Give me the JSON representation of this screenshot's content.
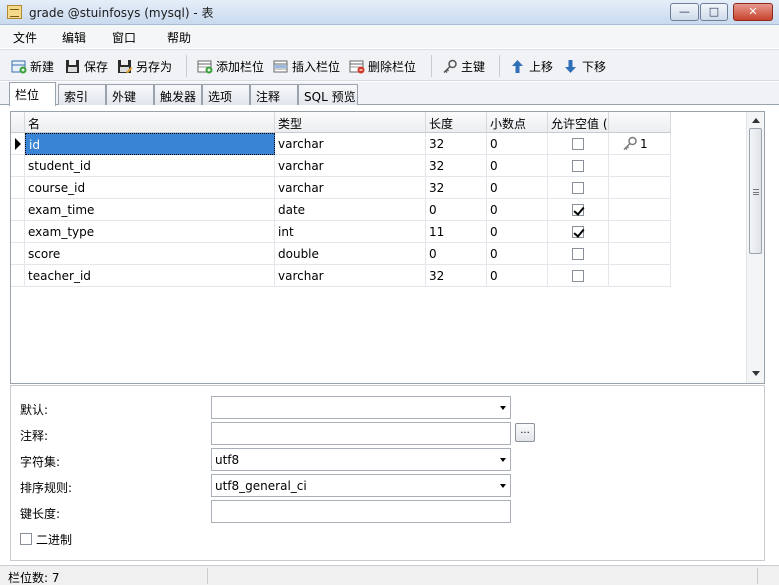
{
  "window": {
    "title": "grade @stuinfosys (mysql) - 表"
  },
  "menu": [
    "文件",
    "编辑",
    "窗口",
    "帮助"
  ],
  "toolbar": {
    "new": "新建",
    "save": "保存",
    "save_as": "另存为",
    "add_field": "添加栏位",
    "insert_field": "插入栏位",
    "delete_field": "删除栏位",
    "primary_key": "主键",
    "move_up": "上移",
    "move_down": "下移"
  },
  "tabs": [
    "栏位",
    "索引",
    "外键",
    "触发器",
    "选项",
    "注释",
    "SQL 预览"
  ],
  "grid": {
    "headers": [
      "名",
      "类型",
      "长度",
      "小数点",
      "允许空值 (",
      ""
    ],
    "rows": [
      {
        "name": "id",
        "type": "varchar",
        "length": "32",
        "decimals": "0",
        "nullable": false,
        "key": "1"
      },
      {
        "name": "student_id",
        "type": "varchar",
        "length": "32",
        "decimals": "0",
        "nullable": false,
        "key": ""
      },
      {
        "name": "course_id",
        "type": "varchar",
        "length": "32",
        "decimals": "0",
        "nullable": false,
        "key": ""
      },
      {
        "name": "exam_time",
        "type": "date",
        "length": "0",
        "decimals": "0",
        "nullable": true,
        "key": ""
      },
      {
        "name": "exam_type",
        "type": "int",
        "length": "11",
        "decimals": "0",
        "nullable": true,
        "key": ""
      },
      {
        "name": "score",
        "type": "double",
        "length": "0",
        "decimals": "0",
        "nullable": false,
        "key": ""
      },
      {
        "name": "teacher_id",
        "type": "varchar",
        "length": "32",
        "decimals": "0",
        "nullable": false,
        "key": ""
      }
    ]
  },
  "properties": {
    "default_label": "默认:",
    "default_value": "",
    "comment_label": "注释:",
    "comment_value": "",
    "charset_label": "字符集:",
    "charset_value": "utf8",
    "collation_label": "排序规则:",
    "collation_value": "utf8_general_ci",
    "key_length_label": "键长度:",
    "key_length_value": "",
    "binary_label": "二进制",
    "binary_checked": false,
    "ellipsis": "..."
  },
  "status": {
    "field_count": "栏位数: 7"
  }
}
